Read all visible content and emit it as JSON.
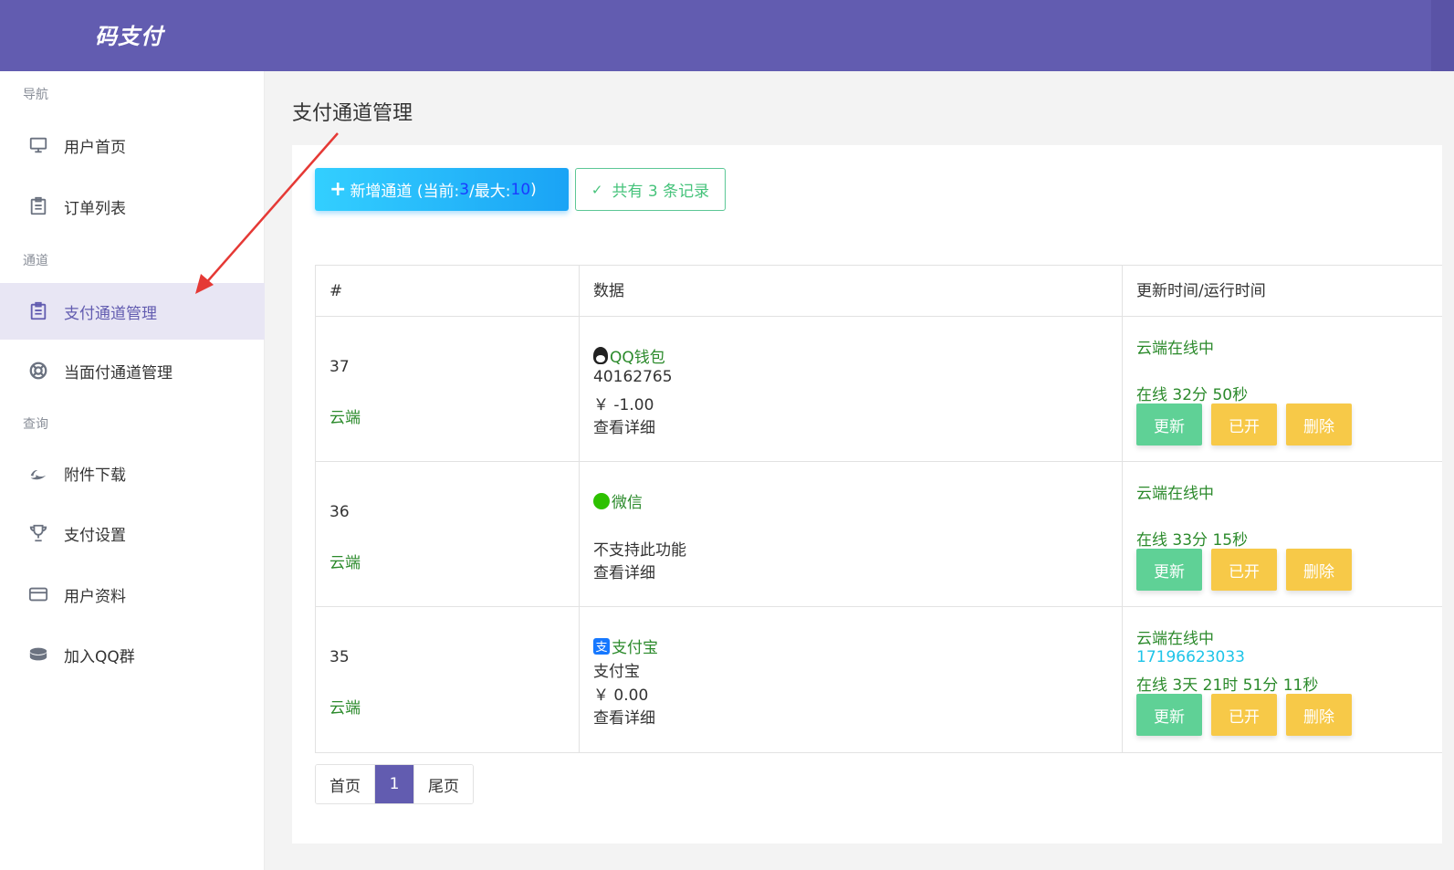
{
  "header": {
    "brand": "码支付"
  },
  "sidebar": {
    "section_nav": "导航",
    "section_channel": "通道",
    "section_query": "查询",
    "items": [
      {
        "label": "用户首页",
        "icon": "monitor-icon"
      },
      {
        "label": "订单列表",
        "icon": "clipboard-icon"
      },
      {
        "label": "支付通道管理",
        "icon": "clipboard-icon",
        "active": true
      },
      {
        "label": "当面付通道管理",
        "icon": "lifebuoy-icon"
      },
      {
        "label": "附件下载",
        "icon": "leaf-icon"
      },
      {
        "label": "支付设置",
        "icon": "trophy-icon"
      },
      {
        "label": "用户资料",
        "icon": "card-icon"
      },
      {
        "label": "加入QQ群",
        "icon": "database-icon"
      }
    ]
  },
  "main": {
    "title": "支付通道管理",
    "add_button": {
      "prefix": "新增通道 (当前:",
      "current": "3",
      "mid": "/最大:",
      "max": "10",
      "suffix": ")"
    },
    "count_button": "共有 3 条记录",
    "table": {
      "headers": [
        "#",
        "数据",
        "更新时间/运行时间"
      ],
      "rows": [
        {
          "id": "37",
          "mode": "云端",
          "channel": "QQ钱包",
          "icon": "qq-icon",
          "line2": "40162765",
          "line3": "￥ -1.00",
          "detail": "查看详细",
          "status": "云端在线中",
          "phone": "",
          "online": "在线 32分 50秒",
          "btn_update": "更新",
          "btn_on": "已开",
          "btn_delete": "删除"
        },
        {
          "id": "36",
          "mode": "云端",
          "channel": "微信",
          "icon": "wechat-icon",
          "line2": "",
          "line3": "不支持此功能",
          "detail": "查看详细",
          "status": "云端在线中",
          "phone": "",
          "online": "在线 33分 15秒",
          "btn_update": "更新",
          "btn_on": "已开",
          "btn_delete": "删除"
        },
        {
          "id": "35",
          "mode": "云端",
          "channel": "支付宝",
          "icon": "alipay-icon",
          "line2": "支付宝",
          "line3": "￥ 0.00",
          "detail": "查看详细",
          "status": "云端在线中",
          "phone": "17196623033",
          "online": "在线 3天 21时 51分 11秒",
          "btn_update": "更新",
          "btn_on": "已开",
          "btn_delete": "删除"
        }
      ]
    },
    "pager": {
      "first": "首页",
      "current": "1",
      "last": "尾页"
    }
  },
  "colors": {
    "brand": "#625cb0",
    "success": "#46c37b",
    "warning": "#f7c948",
    "info": "#1aa3f5",
    "online": "#2b8a2b"
  }
}
